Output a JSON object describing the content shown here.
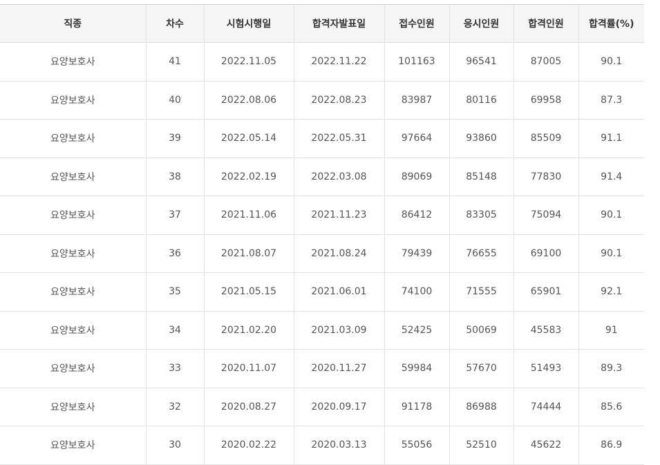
{
  "table": {
    "headers": [
      "직종",
      "차수",
      "시험시행일",
      "합격자발표일",
      "접수인원",
      "응시인원",
      "합격인원",
      "합격률(%)"
    ],
    "rows": [
      [
        "요양보호사",
        "41",
        "2022.11.05",
        "2022.11.22",
        "101163",
        "96541",
        "87005",
        "90.1"
      ],
      [
        "요양보호사",
        "40",
        "2022.08.06",
        "2022.08.23",
        "83987",
        "80116",
        "69958",
        "87.3"
      ],
      [
        "요양보호사",
        "39",
        "2022.05.14",
        "2022.05.31",
        "97664",
        "93860",
        "85509",
        "91.1"
      ],
      [
        "요양보호사",
        "38",
        "2022.02.19",
        "2022.03.08",
        "89069",
        "85148",
        "77830",
        "91.4"
      ],
      [
        "요양보호사",
        "37",
        "2021.11.06",
        "2021.11.23",
        "86412",
        "83305",
        "75094",
        "90.1"
      ],
      [
        "요양보호사",
        "36",
        "2021.08.07",
        "2021.08.24",
        "79439",
        "76655",
        "69100",
        "90.1"
      ],
      [
        "요양보호사",
        "35",
        "2021.05.15",
        "2021.06.01",
        "74100",
        "71555",
        "65901",
        "92.1"
      ],
      [
        "요양보호사",
        "34",
        "2021.02.20",
        "2021.03.09",
        "52425",
        "50069",
        "45583",
        "91"
      ],
      [
        "요양보호사",
        "33",
        "2020.11.07",
        "2020.11.27",
        "59984",
        "57670",
        "51493",
        "89.3"
      ],
      [
        "요양보호사",
        "32",
        "2020.08.27",
        "2020.09.17",
        "91178",
        "86988",
        "74444",
        "85.6"
      ],
      [
        "요양보호사",
        "30",
        "2020.02.22",
        "2020.03.13",
        "55056",
        "52510",
        "45622",
        "86.9"
      ]
    ]
  }
}
